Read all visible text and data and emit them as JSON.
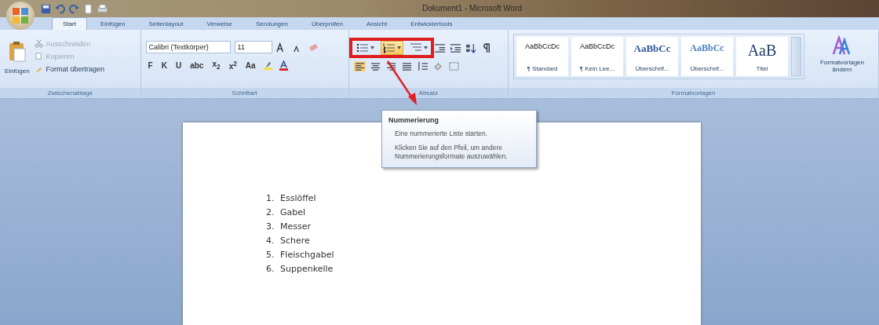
{
  "window": {
    "title": "Dokument1 - Microsoft Word"
  },
  "tabs": [
    {
      "label": "Start",
      "selected": true
    },
    {
      "label": "Einfügen",
      "selected": false
    },
    {
      "label": "Seitenlayout",
      "selected": false
    },
    {
      "label": "Verweise",
      "selected": false
    },
    {
      "label": "Sendungen",
      "selected": false
    },
    {
      "label": "Überprüfen",
      "selected": false
    },
    {
      "label": "Ansicht",
      "selected": false
    },
    {
      "label": "Entwicklertools",
      "selected": false
    }
  ],
  "clipboard": {
    "paste": "Einfügen",
    "items": [
      {
        "label": "Ausschneiden",
        "disabled": true
      },
      {
        "label": "Kopieren",
        "disabled": true
      },
      {
        "label": "Format übertragen",
        "disabled": false
      }
    ],
    "group_label": "Zwischenablage"
  },
  "font": {
    "family": "Calibri (Textkörper)",
    "size": "11",
    "format_buttons": [
      "F",
      "K",
      "U",
      "abc",
      "x$_{2}$",
      "x$^{2}$",
      "Aa"
    ],
    "group_label": "Schriftart"
  },
  "paragraph": {
    "list_buttons": [
      {
        "kind": "bullets",
        "selected": false
      },
      {
        "kind": "numbering",
        "selected": true
      },
      {
        "kind": "multilevel",
        "selected": false
      }
    ],
    "group_label": "Absatz"
  },
  "styles": {
    "items": [
      {
        "preview": "AaBbCcDc",
        "name": "¶ Standard",
        "kind": "body"
      },
      {
        "preview": "AaBbCcDc",
        "name": "¶ Kein Lee...",
        "kind": "body"
      },
      {
        "preview": "AaBbCc",
        "name": "Überschrif...",
        "kind": "heading"
      },
      {
        "preview": "AaBbCc",
        "name": "Überschrif...",
        "kind": "subheading"
      },
      {
        "preview": "AaB",
        "name": "Titel",
        "kind": "title"
      }
    ],
    "change_label": "Formatvorlagen ändern",
    "group_label": "Formatvorlagen"
  },
  "tooltip": {
    "title": "Nummerierung",
    "description": "Eine nummerierte Liste starten.",
    "hint": "Klicken Sie auf den Pfeil, um andere Nummerierungsformate auszuwählen."
  },
  "document": {
    "list": [
      {
        "number": "1.",
        "text": "Esslöffel"
      },
      {
        "number": "2.",
        "text": "Gabel"
      },
      {
        "number": "3.",
        "text": "Messer"
      },
      {
        "number": "4.",
        "text": "Schere"
      },
      {
        "number": "5.",
        "text": "Fleischgabel"
      },
      {
        "number": "6.",
        "text": "Suppenkelle"
      }
    ]
  }
}
